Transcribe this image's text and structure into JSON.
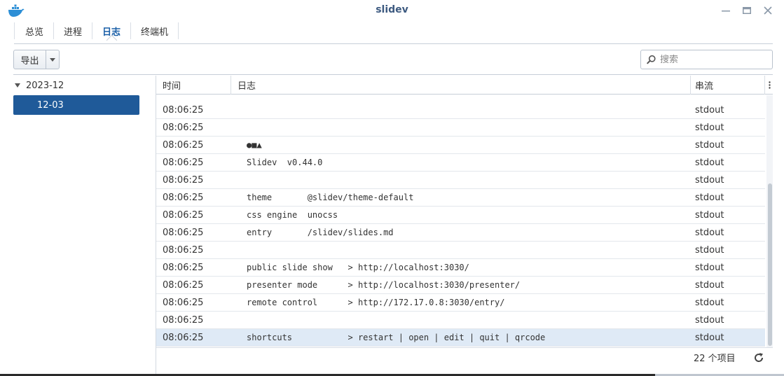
{
  "window": {
    "title": "slidev"
  },
  "tabs": [
    {
      "label": "总览",
      "active": false
    },
    {
      "label": "进程",
      "active": false
    },
    {
      "label": "日志",
      "active": true
    },
    {
      "label": "终端机",
      "active": false
    }
  ],
  "toolbar": {
    "export_label": "导出",
    "search_placeholder": "搜索"
  },
  "tree": {
    "month": "2023-12",
    "day": "12-03"
  },
  "table": {
    "headers": {
      "time": "时间",
      "log": "日志",
      "stream": "串流"
    },
    "rows": [
      {
        "time": "08:06:25",
        "log": "",
        "stream": "stdout"
      },
      {
        "time": "08:06:25",
        "log": "",
        "stream": "stdout"
      },
      {
        "time": "08:06:25",
        "log": "●■▲",
        "stream": "stdout"
      },
      {
        "time": "08:06:25",
        "log": "Slidev  v0.44.0",
        "stream": "stdout"
      },
      {
        "time": "08:06:25",
        "log": "",
        "stream": "stdout"
      },
      {
        "time": "08:06:25",
        "log": "theme       @slidev/theme-default",
        "stream": "stdout"
      },
      {
        "time": "08:06:25",
        "log": "css engine  unocss",
        "stream": "stdout"
      },
      {
        "time": "08:06:25",
        "log": "entry       /slidev/slides.md",
        "stream": "stdout"
      },
      {
        "time": "08:06:25",
        "log": "",
        "stream": "stdout"
      },
      {
        "time": "08:06:25",
        "log": "public slide show   > http://localhost:3030/",
        "stream": "stdout"
      },
      {
        "time": "08:06:25",
        "log": "presenter mode      > http://localhost:3030/presenter/",
        "stream": "stdout"
      },
      {
        "time": "08:06:25",
        "log": "remote control      > http://172.17.0.8:3030/entry/",
        "stream": "stdout"
      },
      {
        "time": "08:06:25",
        "log": "",
        "stream": "stdout"
      },
      {
        "time": "08:06:25",
        "log": "shortcuts           > restart | open | edit | quit | qrcode",
        "stream": "stdout"
      }
    ]
  },
  "footer": {
    "count": "22 个项目"
  },
  "colors": {
    "accent": "#1f5a99",
    "selected_row": "#dfeaf6",
    "title": "#3d5a80"
  }
}
